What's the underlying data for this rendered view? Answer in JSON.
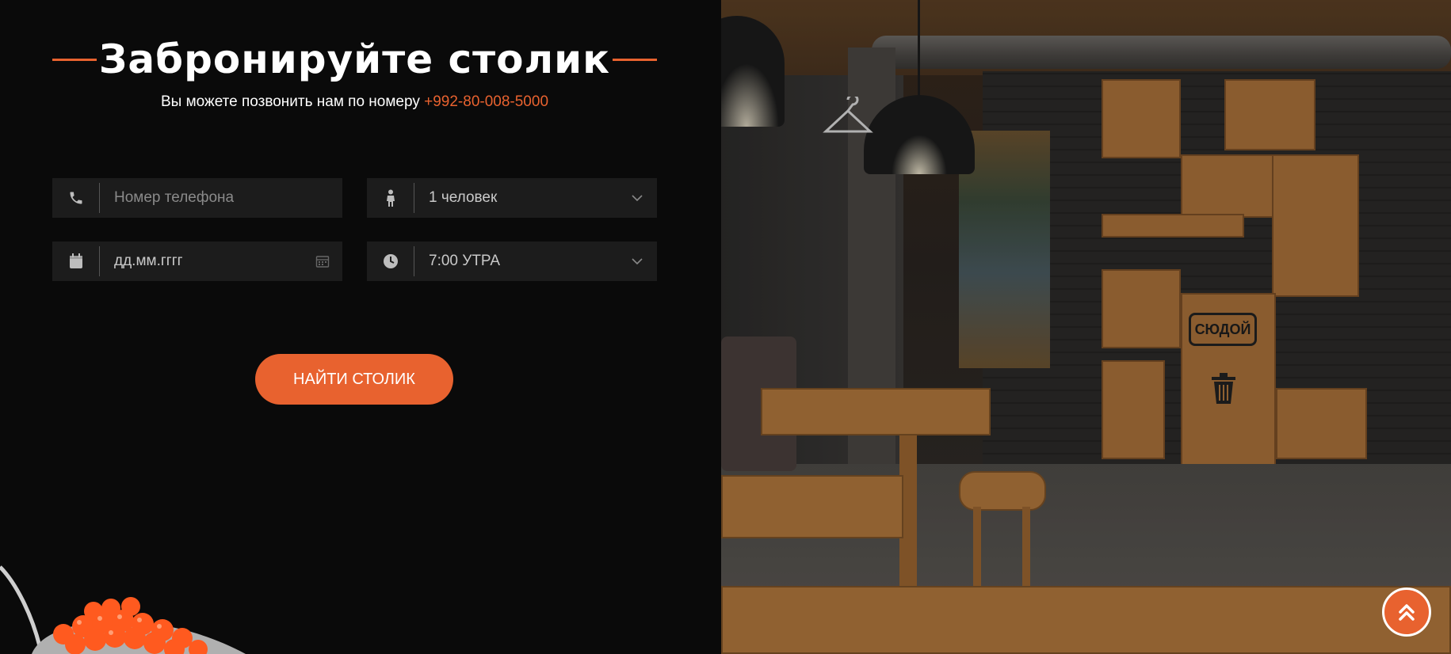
{
  "booking": {
    "title": "Забронируйте столик",
    "subtitle_prefix": "Вы можете позвонить нам по номеру",
    "phone": "+992-80-008-5000",
    "phone_placeholder": "Номер телефона",
    "people_value": "1 человек",
    "date_placeholder": "дд.мм.гггг",
    "time_value": "7:00 УТРА",
    "submit_label": "НАЙТИ СТОЛИК"
  },
  "photo": {
    "sign_text": "СЮДОЙ"
  },
  "colors": {
    "accent": "#e8622f",
    "background": "#0a0a0a",
    "field": "#1c1c1c"
  },
  "icons": [
    "phone-icon",
    "person-icon",
    "calendar-icon",
    "clock-icon",
    "chevron-down-icon",
    "calendar-picker-icon",
    "double-chevron-up-icon"
  ]
}
